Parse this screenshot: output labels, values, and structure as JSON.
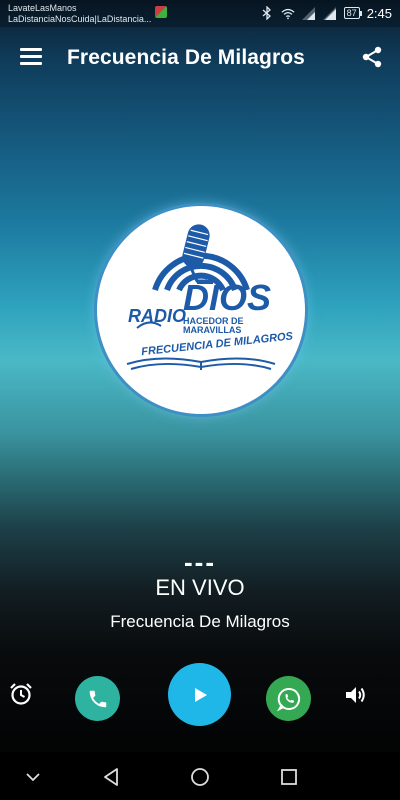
{
  "status_bar": {
    "notification_line1": "LavateLasManos",
    "notification_line2": "LaDistanciaNosCuida|LaDistancia...",
    "battery": "87",
    "time": "2:45"
  },
  "app_bar": {
    "title": "Frecuencia De Milagros"
  },
  "logo": {
    "word_radio": "RADIO",
    "word_dios": "DIOS",
    "tagline_line1": "HACEDOR DE",
    "tagline_line2": "MARAVILLAS",
    "banner": "FRECUENCIA DE MILAGROS"
  },
  "now_playing": {
    "track": "---",
    "status": "EN VIVO",
    "station": "Frecuencia De Milagros"
  },
  "controls": {
    "icons": [
      "alarm-icon",
      "phone-icon",
      "play-icon",
      "whatsapp-icon",
      "volume-icon"
    ]
  },
  "colors": {
    "phone_button": "#2fb3a1",
    "play_button": "#1fb7e8",
    "whatsapp_button": "#34a853",
    "logo_blue": "#1d5aa8"
  }
}
